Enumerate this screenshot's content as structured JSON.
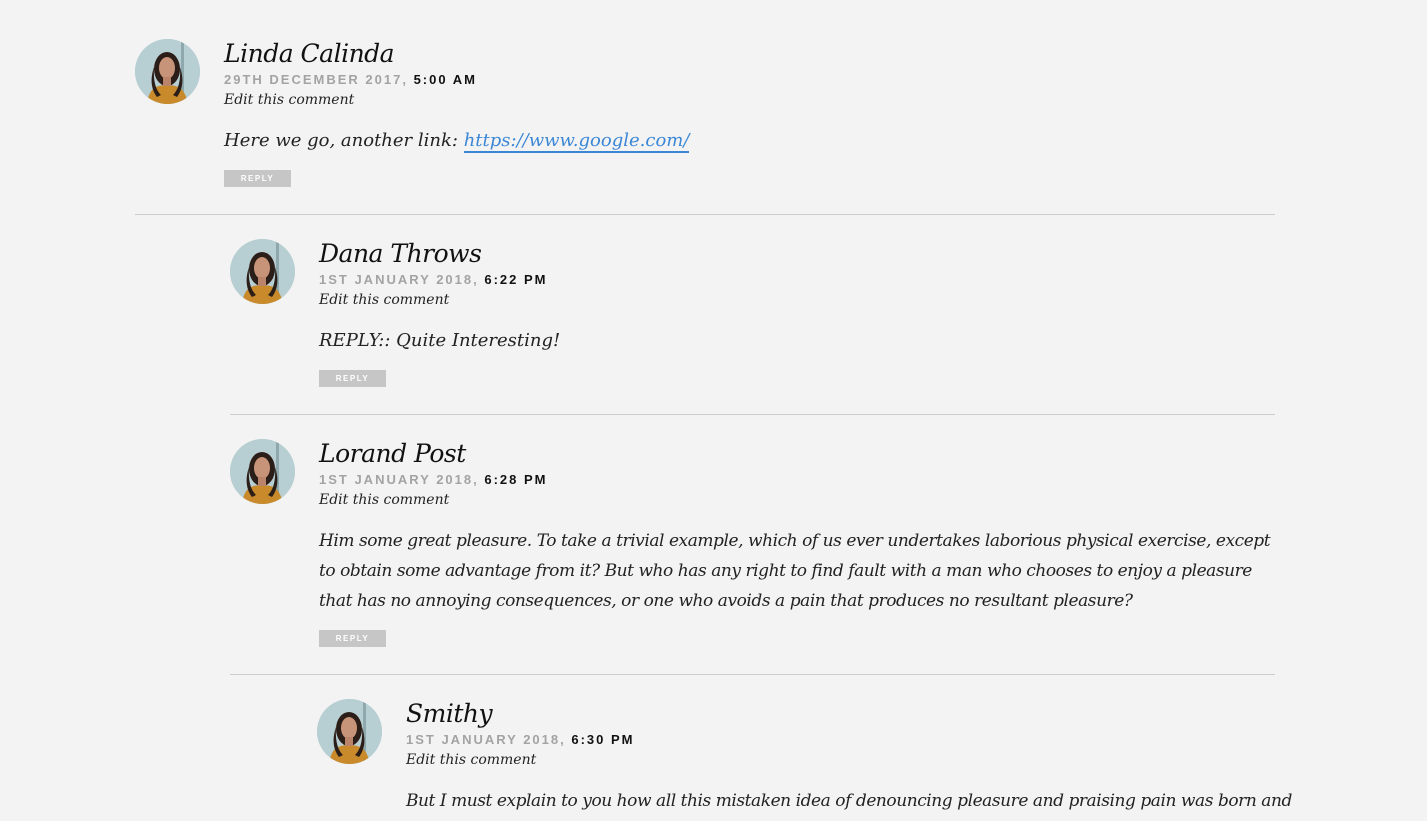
{
  "comments": [
    {
      "author": "Linda Calinda",
      "date": "29th December 2017,",
      "time": "5:00 AM",
      "edit_label": "Edit this comment",
      "text": "Here we go, another link: ",
      "link": "https://www.google.com/",
      "reply_label": "REPLY"
    },
    {
      "author": "Dana Throws",
      "date": "1st January 2018,",
      "time": "6:22 PM",
      "edit_label": "Edit this comment",
      "text": "REPLY:: Quite Interesting!",
      "reply_label": "REPLY"
    },
    {
      "author": "Lorand Post",
      "date": "1st January 2018,",
      "time": "6:28 PM",
      "edit_label": "Edit this comment",
      "text": "Him some great pleasure. To take a trivial example, which of us ever undertakes laborious physical exercise, except to obtain some advantage from it? But who has any right to find fault with a man who chooses to enjoy a pleasure that has no annoying consequences, or one who avoids a pain that produces no resultant pleasure?",
      "reply_label": "REPLY"
    },
    {
      "author": "Smithy",
      "date": "1st January 2018,",
      "time": "6:30 PM",
      "edit_label": "Edit this comment",
      "text": "But I must explain to you how all this mistaken idea of denouncing pleasure and praising pain was born and"
    }
  ],
  "colors": {
    "background": "#f3f3f3",
    "link": "#3b87d6",
    "reply_button": "#c6c6c6",
    "divider": "#cdcdcd"
  }
}
